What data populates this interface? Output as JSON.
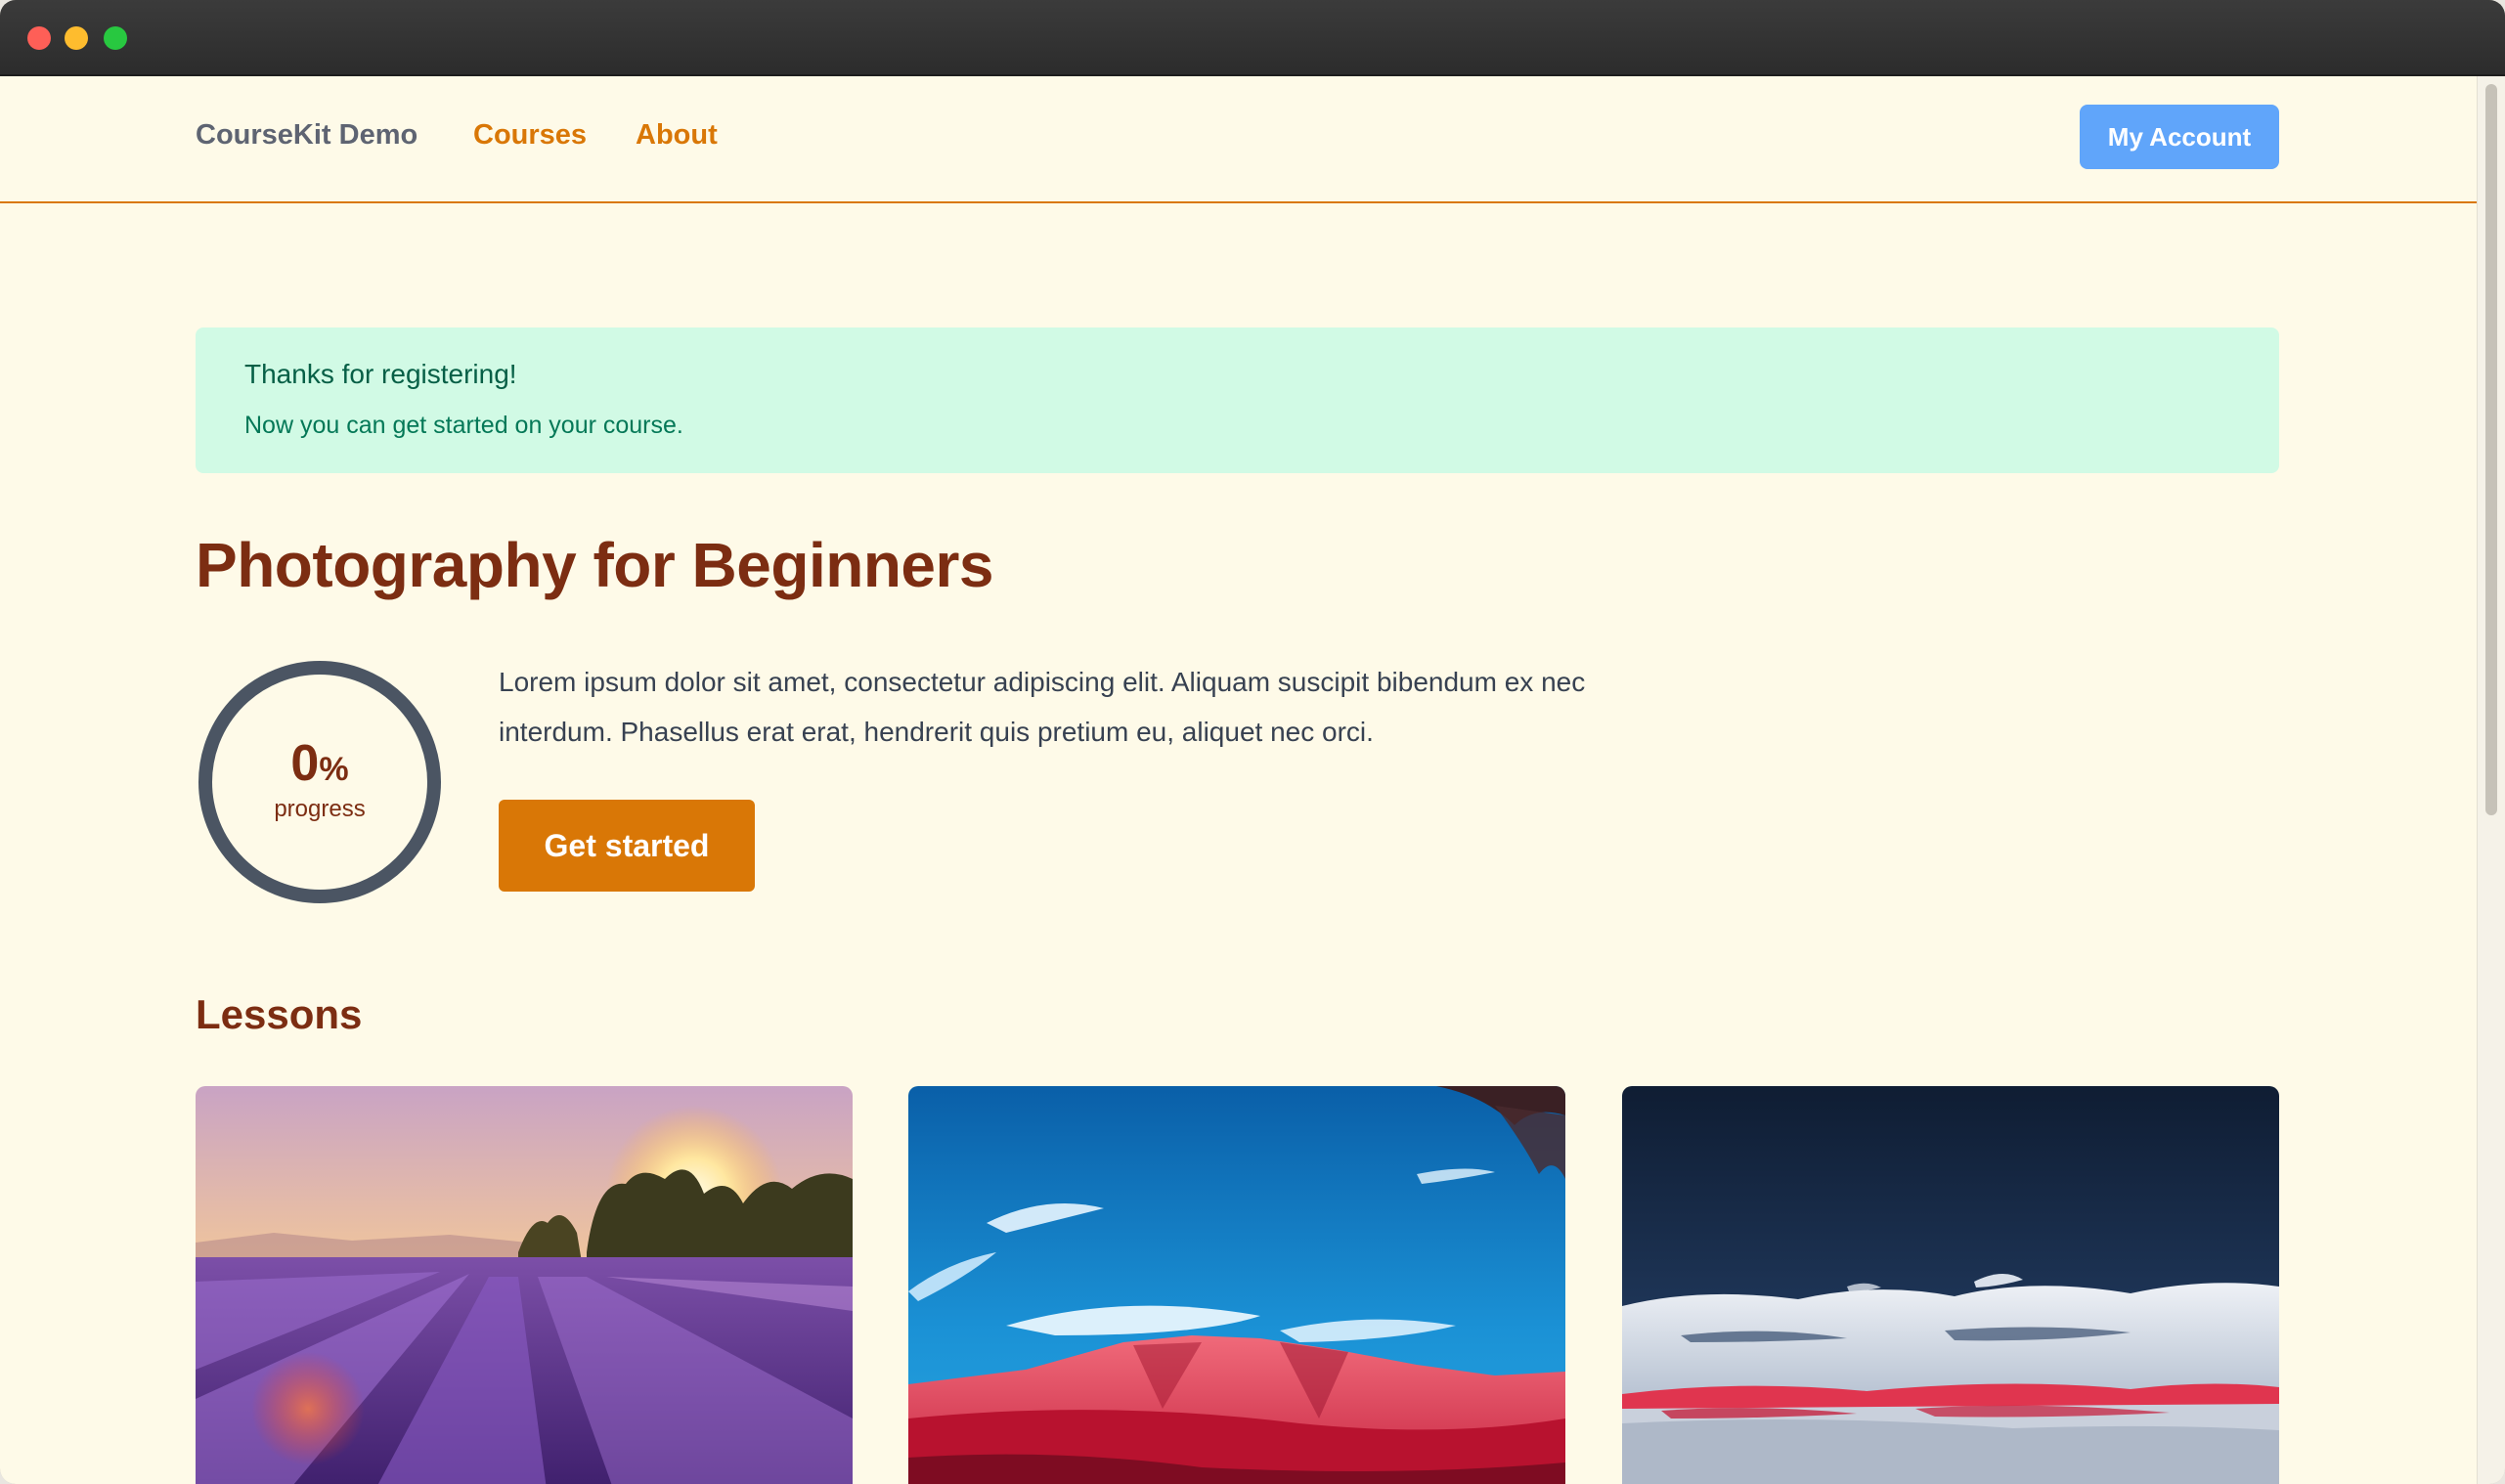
{
  "nav": {
    "brand": "CourseKit Demo",
    "links": [
      {
        "label": "Courses"
      },
      {
        "label": "About"
      }
    ],
    "account_button": "My Account"
  },
  "alert": {
    "title": "Thanks for registering!",
    "text": "Now you can get started on your course."
  },
  "course": {
    "title": "Photography for Beginners",
    "progress": {
      "value": "0",
      "unit": "%",
      "label": "progress",
      "fraction": 0
    },
    "description": "Lorem ipsum dolor sit amet, consectetur adipiscing elit. Aliquam suscipit bibendum ex nec interdum. Phasellus erat erat, hendrerit quis pretium eu, aliquet nec orci.",
    "start_button": "Get started"
  },
  "lessons": {
    "heading": "Lessons",
    "cards": [
      {
        "image": "lavender-field-sunset-photo"
      },
      {
        "image": "red-infrared-mountain-blue-sky-photo"
      },
      {
        "image": "infrared-landscape-night-sky-photo"
      }
    ]
  },
  "colors": {
    "page_background": "#fefae8",
    "accent": "#d97706",
    "heading": "#7c2d12",
    "account_button": "#60a5fa",
    "alert_background": "#d1fae5",
    "alert_text": "#065f46",
    "progress_ring": "#4b5563"
  }
}
